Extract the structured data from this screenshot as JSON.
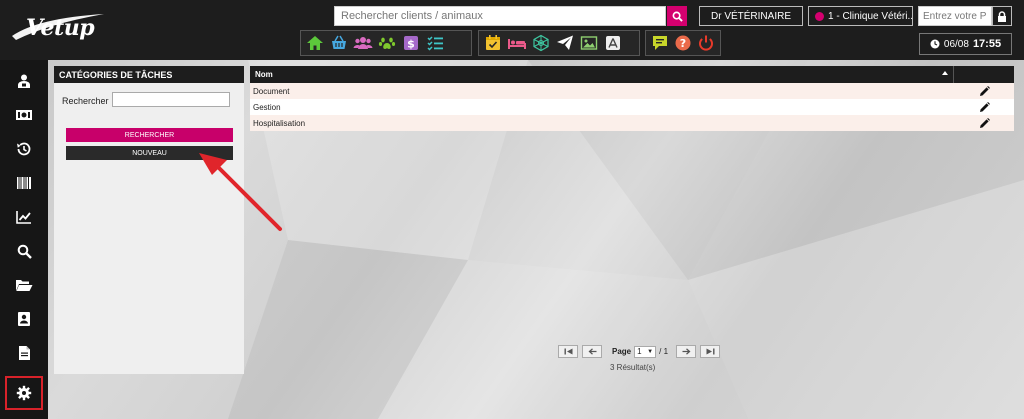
{
  "app": {
    "logo_text": "Vetup"
  },
  "header": {
    "search_placeholder": "Rechercher clients / animaux",
    "vet_label": "Dr VÉTÉRINAIRE",
    "clinic_label": "1 - Clinique Vétéri..",
    "pin_placeholder": "Entrez votre PIN",
    "date": "06/08",
    "time": "17:55"
  },
  "toolbar": {
    "group1": [
      "home-icon",
      "basket-icon",
      "clients-icon",
      "paw-icon",
      "dollar-icon",
      "checklist-icon"
    ],
    "group2": [
      "calendar-check-icon",
      "bed-icon",
      "network-icon",
      "paper-plane-icon",
      "image-icon",
      "app-store-icon"
    ],
    "group3": [
      "chat-icon",
      "help-icon",
      "power-icon"
    ]
  },
  "sidebar": {
    "items": [
      "user-badge-icon",
      "cash-icon",
      "history-icon",
      "barcode-icon",
      "chart-icon",
      "search-icon",
      "folder-open-icon",
      "contact-card-icon",
      "file-icon",
      "gear-icon"
    ],
    "active": "gear-icon"
  },
  "panel": {
    "title": "CATÉGORIES DE TÂCHES",
    "search_label": "Rechercher",
    "search_value": "",
    "search_button": "RECHERCHER",
    "new_button": "NOUVEAU"
  },
  "table": {
    "header": "Nom",
    "rows": [
      "Document",
      "Gestion",
      "Hospitalisation"
    ]
  },
  "pagination": {
    "page_label": "Page",
    "current_page": "1",
    "total": "/ 1",
    "results": "3 Résultat(s)"
  },
  "colors": {
    "brand": "#d4006f",
    "dark": "#1d1d1d",
    "annotation": "#e0252b"
  }
}
